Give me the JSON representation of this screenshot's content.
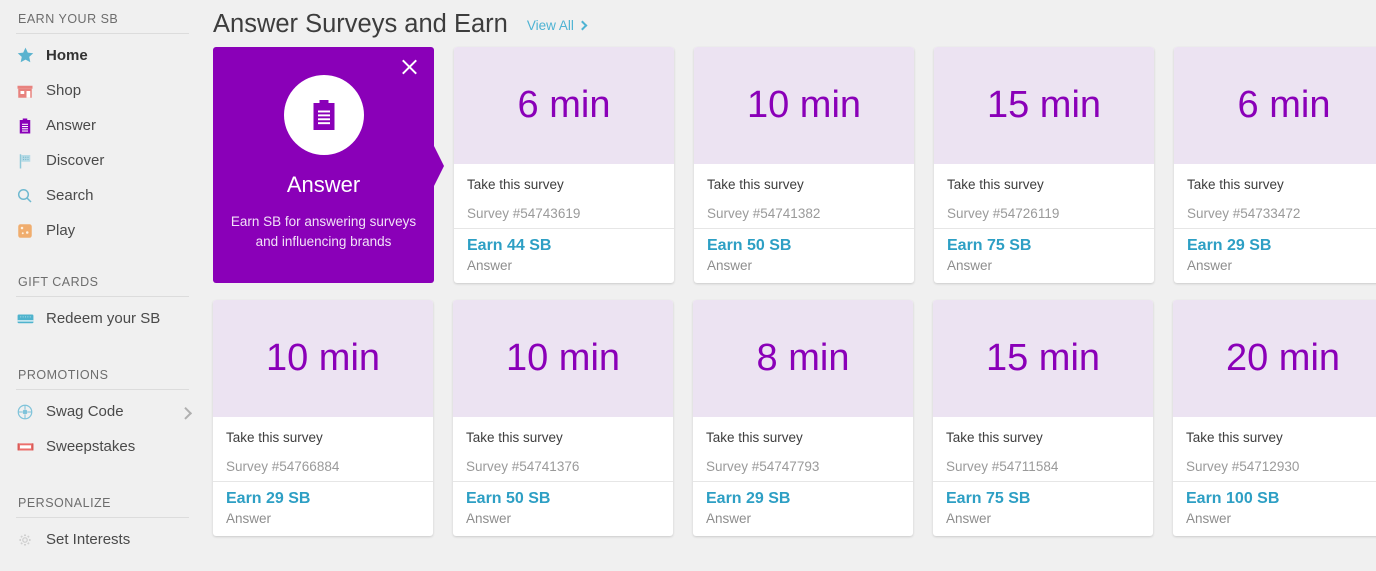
{
  "sidebar": {
    "groups": [
      {
        "title": "EARN YOUR SB",
        "items": [
          {
            "label": "Home",
            "icon": "star-icon",
            "active": true
          },
          {
            "label": "Shop",
            "icon": "shop-icon",
            "active": false
          },
          {
            "label": "Answer",
            "icon": "clipboard-icon",
            "active": false
          },
          {
            "label": "Discover",
            "icon": "flag-icon",
            "active": false
          },
          {
            "label": "Search",
            "icon": "magnifier-icon",
            "active": false
          },
          {
            "label": "Play",
            "icon": "dice-icon",
            "active": false
          }
        ]
      },
      {
        "title": "GIFT CARDS",
        "items": [
          {
            "label": "Redeem your SB",
            "icon": "giftcard-icon",
            "active": false
          }
        ]
      },
      {
        "title": "PROMOTIONS",
        "items": [
          {
            "label": "Swag Code",
            "icon": "swagcode-icon",
            "active": false,
            "chevron": true
          },
          {
            "label": "Sweepstakes",
            "icon": "ticket-icon",
            "active": false
          }
        ]
      },
      {
        "title": "PERSONALIZE",
        "items": [
          {
            "label": "Set Interests",
            "icon": "gear-icon",
            "active": false
          }
        ]
      }
    ]
  },
  "header": {
    "title": "Answer Surveys and Earn",
    "view_all_label": "View All"
  },
  "promo": {
    "name": "Answer",
    "description": "Earn SB for answering surveys and influencing brands",
    "icon": "clipboard-icon",
    "close_icon": "close-icon",
    "background": "#8a00b8"
  },
  "colors": {
    "purple": "#8a00b8",
    "card_header": "#ece3f2",
    "teal": "#2d9fc4",
    "link": "#4eb3d3",
    "page_bg": "#f0f0f0"
  },
  "labels": {
    "take": "Take this survey",
    "action": "Answer"
  },
  "surveys": {
    "row1": [
      {
        "time": "6 min",
        "take": "Take this survey",
        "id": "Survey #54743619",
        "earn": "Earn 44 SB",
        "action": "Answer"
      },
      {
        "time": "10 min",
        "take": "Take this survey",
        "id": "Survey #54741382",
        "earn": "Earn 50 SB",
        "action": "Answer"
      },
      {
        "time": "15 min",
        "take": "Take this survey",
        "id": "Survey #54726119",
        "earn": "Earn 75 SB",
        "action": "Answer"
      },
      {
        "time": "6 min",
        "take": "Take this survey",
        "id": "Survey #54733472",
        "earn": "Earn 29 SB",
        "action": "Answer"
      }
    ],
    "row2": [
      {
        "time": "10 min",
        "take": "Take this survey",
        "id": "Survey #54766884",
        "earn": "Earn 29 SB",
        "action": "Answer"
      },
      {
        "time": "10 min",
        "take": "Take this survey",
        "id": "Survey #54741376",
        "earn": "Earn 50 SB",
        "action": "Answer"
      },
      {
        "time": "8 min",
        "take": "Take this survey",
        "id": "Survey #54747793",
        "earn": "Earn 29 SB",
        "action": "Answer"
      },
      {
        "time": "15 min",
        "take": "Take this survey",
        "id": "Survey #54711584",
        "earn": "Earn 75 SB",
        "action": "Answer"
      },
      {
        "time": "20 min",
        "take": "Take this survey",
        "id": "Survey #54712930",
        "earn": "Earn 100 SB",
        "action": "Answer"
      }
    ]
  }
}
